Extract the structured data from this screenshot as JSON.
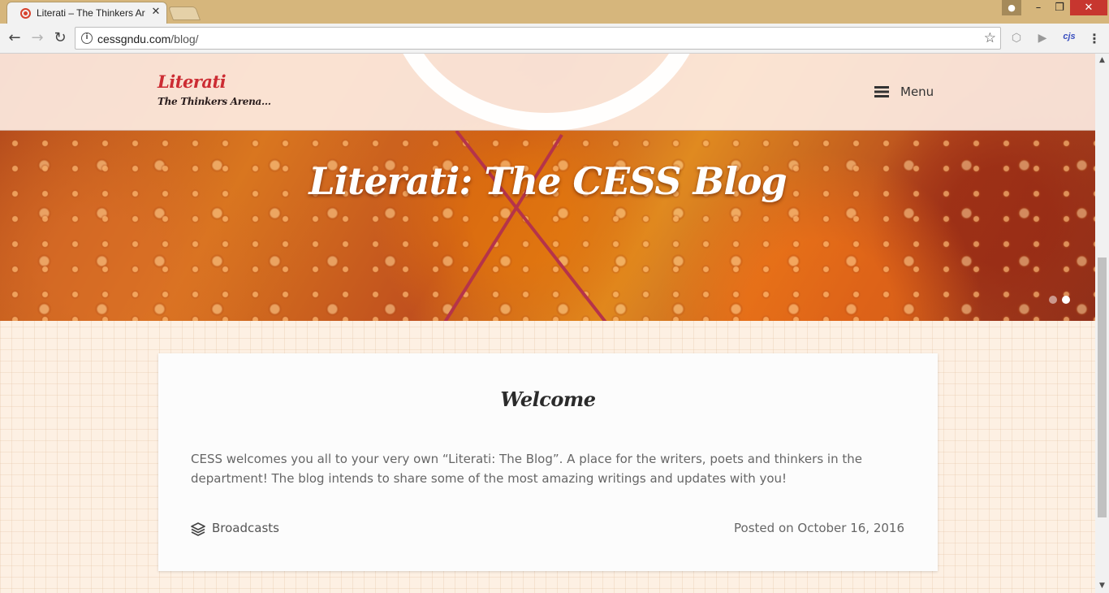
{
  "browser": {
    "tab_title": "Literati – The Thinkers Ar",
    "tab_close": "✕",
    "url_host": "cessgndu.com",
    "url_path": "/blog/",
    "ext_label": "cjs"
  },
  "site": {
    "title": "Literati",
    "tagline": "The Thinkers Arena…",
    "menu_label": "Menu"
  },
  "hero": {
    "title": "Literati: The CESS Blog",
    "slides": 2,
    "active_slide": 2
  },
  "post": {
    "title": "Welcome",
    "body": "CESS welcomes you all to your very own “Literati: The Blog”. A place for the writers, poets and thinkers in the department! The blog intends to share some of the most amazing writings and updates with you!",
    "category": "Broadcasts",
    "date_text": "Posted on October 16, 2016"
  },
  "colors": {
    "accent": "#cc2c33",
    "tabbar": "#d6b67c",
    "page_bg": "#fdf0e3"
  }
}
